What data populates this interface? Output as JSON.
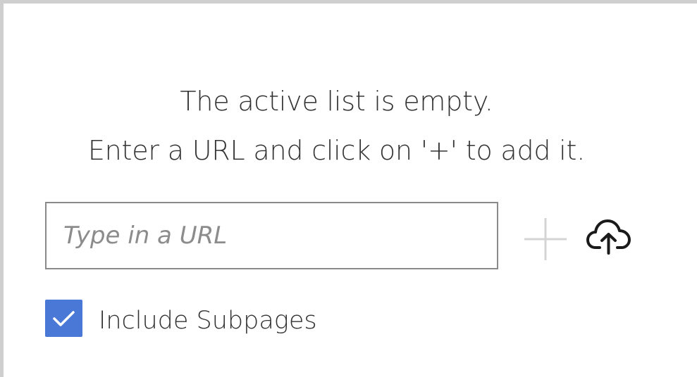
{
  "empty_state": {
    "line1": "The active list is empty.",
    "line2": "Enter a URL and click on '+' to add it."
  },
  "url_input": {
    "value": "",
    "placeholder": "Type in a URL"
  },
  "add_button": {
    "icon": "plus-icon",
    "color": "#d4d4d4"
  },
  "upload_button": {
    "icon": "cloud-upload-icon",
    "color": "#1a1a1a"
  },
  "include_subpages": {
    "label": "Include Subpages",
    "checked": true,
    "color": "#4a78d6"
  }
}
